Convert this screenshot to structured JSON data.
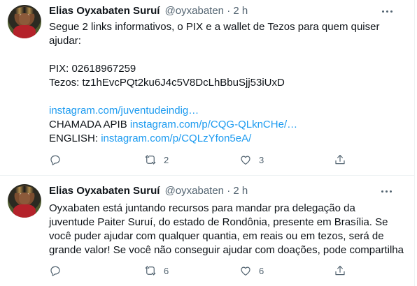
{
  "tweets": [
    {
      "author": {
        "name": "Elias Oyxabaten Suruí",
        "handle": "@oyxabaten"
      },
      "separator": "·",
      "time": "2 h",
      "lines": [
        {
          "text": "Segue 2 links informativos, o PIX e a wallet de Tezos para quem quiser"
        },
        {
          "text": "ajudar:"
        },
        {
          "text": ""
        },
        {
          "text": "PIX: 02618967259"
        },
        {
          "text": "Tezos: tz1hEvcPQt2ku6J4c5V8DcLhBbuSjj53iUxD"
        },
        {
          "text": ""
        },
        {
          "link": "instagram.com/juventudeindig…"
        },
        {
          "text": "CHAMADA APIB ",
          "link": "instagram.com/p/CQG-QLknCHe/…"
        },
        {
          "text": "ENGLISH: ",
          "link": "instagram.com/p/CQLzYfon5eA/"
        }
      ],
      "actions": {
        "replies": "",
        "retweets": "2",
        "likes": "3"
      }
    },
    {
      "author": {
        "name": "Elias Oyxabaten Suruí",
        "handle": "@oyxabaten"
      },
      "separator": "·",
      "time": "2 h",
      "lines": [
        {
          "text": "Oyxabaten está juntando recursos para mandar pra delegação da"
        },
        {
          "text": "juventude Paiter Suruí, do estado de Rondônia, presente em Brasília. Se"
        },
        {
          "text": "você puder ajudar com qualquer quantia, em reais ou em tezos, será de"
        },
        {
          "text": "grande valor! Se você não conseguir ajudar com doações, pode compartilha"
        }
      ],
      "actions": {
        "replies": "",
        "retweets": "6",
        "likes": "6"
      }
    }
  ],
  "icons": {
    "reply": "reply-icon",
    "retweet": "retweet-icon",
    "like": "heart-icon",
    "share": "share-icon",
    "more": "more-icon"
  },
  "colors": {
    "link": "#1d9bf0",
    "secondary_text": "#536471",
    "divider": "#eff3f4"
  }
}
